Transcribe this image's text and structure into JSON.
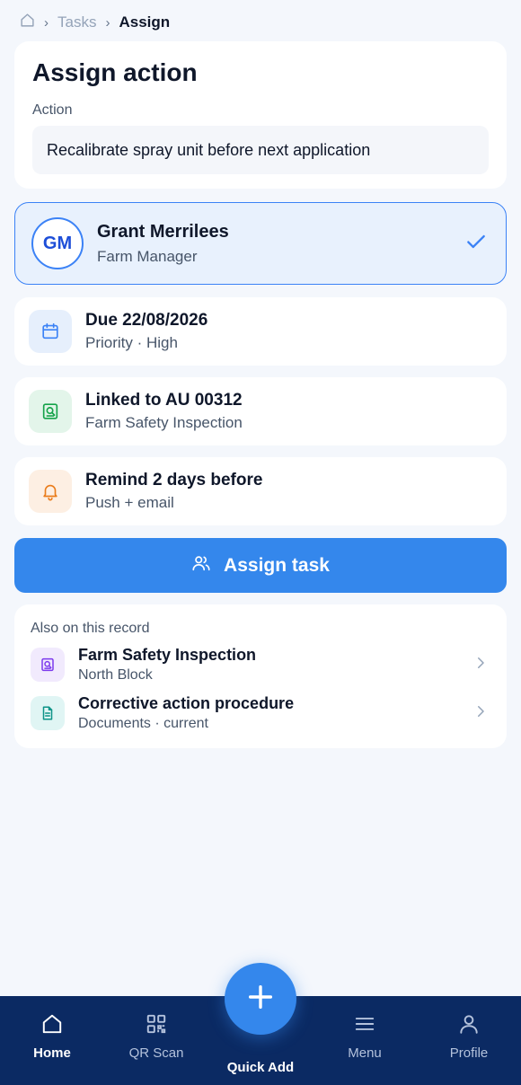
{
  "breadcrumb": {
    "items": [
      "Tasks"
    ],
    "current": "Assign"
  },
  "assign": {
    "title": "Assign action",
    "action_label": "Action",
    "action_value": "Recalibrate spray unit before next application"
  },
  "assignee": {
    "initials": "GM",
    "name": "Grant Merrilees",
    "role": "Farm Manager"
  },
  "due": {
    "title": "Due 22/08/2026",
    "subtitle": "Priority · High"
  },
  "linked": {
    "title": "Linked to AU 00312",
    "subtitle": "Farm Safety Inspection"
  },
  "remind": {
    "title": "Remind 2 days before",
    "subtitle": "Push + email"
  },
  "assign_button": {
    "label": "Assign task"
  },
  "record": {
    "heading": "Also on this record",
    "items": [
      {
        "title": "Farm Safety Inspection",
        "subtitle": "North Block",
        "icon": "inspection-icon"
      },
      {
        "title": "Corrective action procedure",
        "subtitle": "Documents · current",
        "icon": "document-icon"
      }
    ]
  },
  "nav": {
    "home": "Home",
    "qr": "QR Scan",
    "quick_add": "Quick Add",
    "menu": "Menu",
    "profile": "Profile"
  },
  "colors": {
    "accent": "#3487ec",
    "nav_bg": "#0b2a63",
    "selected_bg": "#e8f1fd",
    "page_bg": "#f4f7fc"
  }
}
